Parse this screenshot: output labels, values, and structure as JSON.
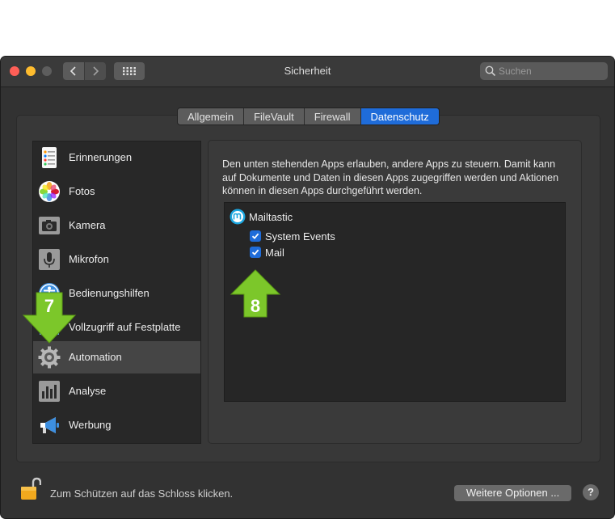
{
  "window": {
    "title": "Sicherheit"
  },
  "search": {
    "placeholder": "Suchen"
  },
  "tabs": [
    {
      "label": "Allgemein",
      "active": false
    },
    {
      "label": "FileVault",
      "active": false
    },
    {
      "label": "Firewall",
      "active": false
    },
    {
      "label": "Datenschutz",
      "active": true
    }
  ],
  "sidebar": {
    "selected": "Automation",
    "items": [
      {
        "label": "Erinnerungen",
        "icon": "reminders-icon"
      },
      {
        "label": "Fotos",
        "icon": "photos-icon"
      },
      {
        "label": "Kamera",
        "icon": "camera-icon"
      },
      {
        "label": "Mikrofon",
        "icon": "microphone-icon"
      },
      {
        "label": "Bedienungshilfen",
        "icon": "accessibility-icon"
      },
      {
        "label": "Vollzugriff auf Festplatte",
        "icon": "folder-icon"
      },
      {
        "label": "Automation",
        "icon": "gear-icon"
      },
      {
        "label": "Analyse",
        "icon": "analytics-icon"
      },
      {
        "label": "Werbung",
        "icon": "megaphone-icon"
      }
    ]
  },
  "main": {
    "description": "Den unten stehenden Apps erlauben, andere Apps zu steuern. Damit kann auf Dokumente und Daten in diesen Apps zugegriffen werden und Aktionen können in diesen Apps durchgeführt werden.",
    "app": {
      "name": "Mailtastic",
      "targets": [
        {
          "label": "System Events",
          "checked": true
        },
        {
          "label": "Mail",
          "checked": true
        }
      ]
    }
  },
  "annotations": [
    {
      "number": "7",
      "direction": "down"
    },
    {
      "number": "8",
      "direction": "up"
    }
  ],
  "footer": {
    "lock_text": "Zum Schützen auf das Schloss klicken.",
    "more_options_label": "Weitere Optionen ...",
    "help_label": "?"
  },
  "colors": {
    "accent": "#1f6cd9",
    "annotation_green": "#7cc72a",
    "window_bg": "#323232"
  }
}
